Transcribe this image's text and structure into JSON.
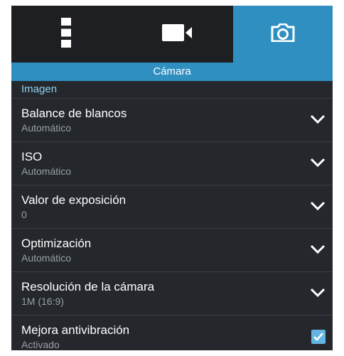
{
  "tabs": [
    {
      "icon": "more-vertical-icon",
      "active": false
    },
    {
      "icon": "video-camera-icon",
      "active": false
    },
    {
      "icon": "camera-icon",
      "active": true
    }
  ],
  "section_title": "Cámara",
  "group_label": "Imagen",
  "settings": [
    {
      "title": "Balance de blancos",
      "value": "Automático",
      "control": "chevron-down-icon"
    },
    {
      "title": "ISO",
      "value": "Automático",
      "control": "chevron-down-icon"
    },
    {
      "title": "Valor de exposición",
      "value": "0",
      "control": "chevron-down-icon"
    },
    {
      "title": "Optimización",
      "value": "Automático",
      "control": "chevron-down-icon"
    },
    {
      "title": "Resolución de la cámara",
      "value": "1M (16:9)",
      "control": "chevron-down-icon"
    },
    {
      "title": "Mejora antivibración",
      "value": "Activado",
      "control": "checkbox",
      "checked": true
    }
  ],
  "colors": {
    "accent": "#2f8fc1",
    "background": "#24272c",
    "tabbar": "#1d1f22",
    "group_label": "#8fd0ee",
    "checkbox": "#64b5e1"
  }
}
